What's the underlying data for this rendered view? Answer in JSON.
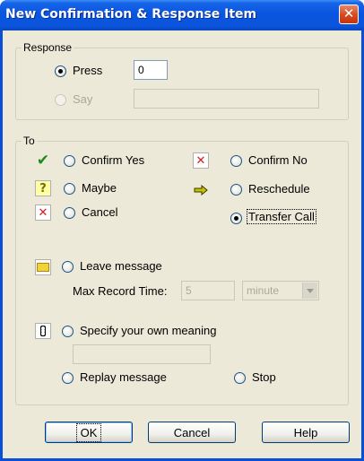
{
  "window": {
    "title": "New Confirmation & Response Item",
    "close_symbol": "✕"
  },
  "response": {
    "legend": "Response",
    "press_label": "Press",
    "press_value": "0",
    "press_selected": true,
    "say_label": "Say",
    "say_value": "",
    "say_enabled": false
  },
  "to": {
    "legend": "To",
    "options": {
      "confirm_yes": {
        "label": "Confirm Yes",
        "icon": "checkmark-icon",
        "selected": false
      },
      "confirm_no": {
        "label": "Confirm No",
        "icon": "red-x-icon",
        "selected": false
      },
      "maybe": {
        "label": "Maybe",
        "icon": "question-mark-icon",
        "selected": false
      },
      "reschedule": {
        "label": "Reschedule",
        "icon": "arrow-right-icon",
        "selected": false
      },
      "cancel": {
        "label": "Cancel",
        "icon": "red-x-icon",
        "selected": false
      },
      "transfer_call": {
        "label": "Transfer Call",
        "icon": "",
        "selected": true
      },
      "leave_message": {
        "label": "Leave message",
        "icon": "envelope-icon",
        "selected": false
      },
      "specify_meaning": {
        "label": "Specify your own meaning",
        "icon": "traffic-light-icon",
        "selected": false
      },
      "replay_message": {
        "label": "Replay message",
        "selected": false
      },
      "stop": {
        "label": "Stop",
        "selected": false
      }
    },
    "max_record_label": "Max Record Time:",
    "max_record_value": "5",
    "max_record_unit": "minute",
    "own_meaning_value": ""
  },
  "buttons": {
    "ok": "OK",
    "cancel": "Cancel",
    "help": "Help"
  }
}
